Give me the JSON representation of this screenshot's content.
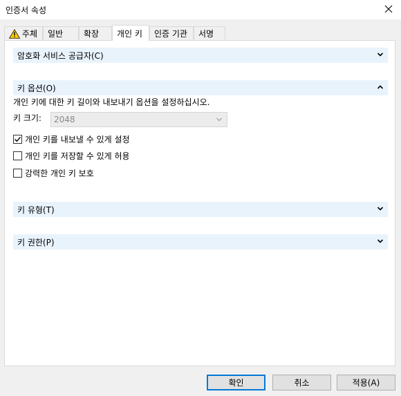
{
  "window": {
    "title": "인증서 속성"
  },
  "tabs": [
    {
      "label": "주체"
    },
    {
      "label": "일반"
    },
    {
      "label": "확장"
    },
    {
      "label": "개인 키"
    },
    {
      "label": "인증 기관"
    },
    {
      "label": "서명"
    }
  ],
  "sections": {
    "crypto_provider": {
      "label": "암호화 서비스 공급자(C)"
    },
    "key_options": {
      "label": "키 옵션(O)",
      "description": "개인 키에 대한 키 길이와 내보내기 옵션을 설정하십시오.",
      "key_size_label": "키 크기:",
      "key_size_value": "2048",
      "checks": [
        {
          "label": "개인 키를 내보낼 수 있게 설정",
          "checked": true
        },
        {
          "label": "개인 키를 저장할 수 있게 허용",
          "checked": false
        },
        {
          "label": "강력한 개인 키 보호",
          "checked": false
        }
      ]
    },
    "key_type": {
      "label": "키 유형(T)"
    },
    "key_permissions": {
      "label": "키 권한(P)"
    }
  },
  "buttons": {
    "ok": "확인",
    "cancel": "취소",
    "apply": "적용(A)"
  },
  "colors": {
    "section_bg": "#e9f3fc",
    "accent": "#0078d7"
  },
  "icons": {
    "subject_tab_icon": "warning-icon",
    "close": "close-icon"
  }
}
